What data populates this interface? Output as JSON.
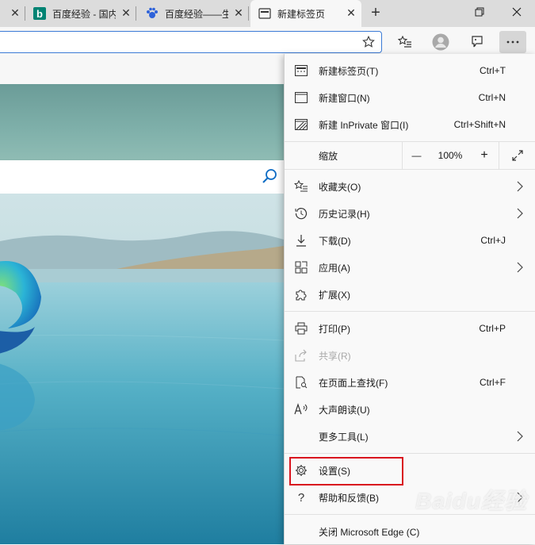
{
  "tabs": [
    {
      "title": "",
      "icon": "close-icon"
    },
    {
      "title": "百度经验 - 国内",
      "icon": "bing-icon"
    },
    {
      "title": "百度经验——生活",
      "icon": "baidu-paw-icon"
    },
    {
      "title": "新建标签页",
      "icon": "newtab-page-icon",
      "active": true
    }
  ],
  "toolbar": {
    "favorite_icon": "star-outline-icon",
    "buttons": [
      "favorites-list-icon",
      "profile-avatar",
      "feedback-icon",
      "more-icon"
    ]
  },
  "menu": {
    "items": [
      {
        "label": "新建标签页(T)",
        "shortcut": "Ctrl+T",
        "icon": "new-tab-icon"
      },
      {
        "label": "新建窗口(N)",
        "shortcut": "Ctrl+N",
        "icon": "new-window-icon"
      },
      {
        "label": "新建 InPrivate 窗口(I)",
        "shortcut": "Ctrl+Shift+N",
        "icon": "inprivate-icon"
      },
      {
        "label": "缩放",
        "zoom_value": "100%",
        "minus": "—",
        "plus": "+"
      },
      {
        "label": "收藏夹(O)",
        "icon": "favorites-icon",
        "submenu": true
      },
      {
        "label": "历史记录(H)",
        "icon": "history-icon",
        "submenu": true
      },
      {
        "label": "下载(D)",
        "shortcut": "Ctrl+J",
        "icon": "download-icon"
      },
      {
        "label": "应用(A)",
        "icon": "apps-icon",
        "submenu": true
      },
      {
        "label": "扩展(X)",
        "icon": "extensions-icon"
      },
      {
        "label": "打印(P)",
        "shortcut": "Ctrl+P",
        "icon": "print-icon"
      },
      {
        "label": "共享(R)",
        "icon": "share-icon",
        "disabled": true
      },
      {
        "label": "在页面上查找(F)",
        "shortcut": "Ctrl+F",
        "icon": "find-icon"
      },
      {
        "label": "大声朗读(U)",
        "icon": "read-aloud-icon"
      },
      {
        "label": "更多工具(L)",
        "submenu": true
      },
      {
        "label": "设置(S)",
        "icon": "gear-icon",
        "highlighted": true
      },
      {
        "label": "帮助和反馈(B)",
        "icon": "help-icon",
        "submenu": true
      },
      {
        "label": "关闭 Microsoft Edge (C)"
      }
    ]
  },
  "highlight_color": "#d9141e",
  "watermark": "Baidu经验"
}
